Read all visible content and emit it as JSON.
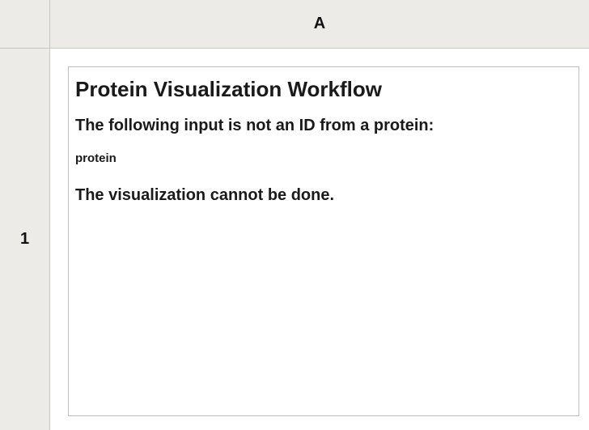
{
  "spreadsheet": {
    "column_header": "A",
    "row_header": "1"
  },
  "cell": {
    "title": "Protein Visualization Workflow",
    "message_line_1": "The following input is not an ID from a protein:",
    "input_value": "protein",
    "message_line_2": "The visualization cannot be done."
  }
}
